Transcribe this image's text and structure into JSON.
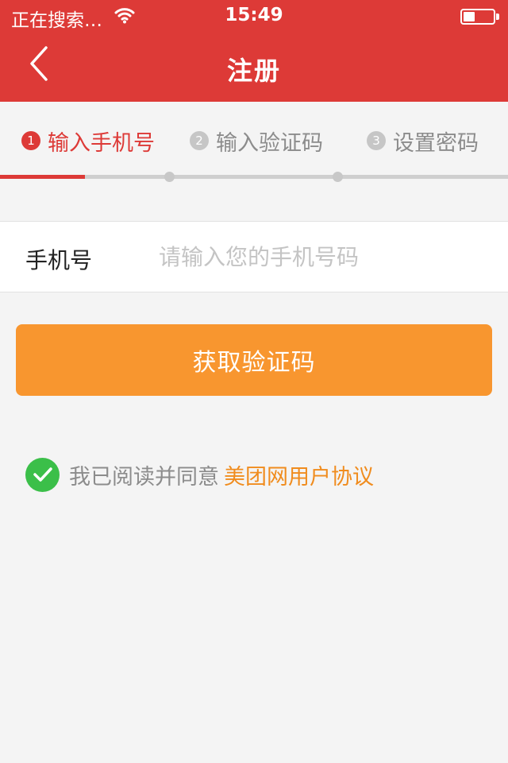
{
  "status_bar": {
    "carrier": "正在搜索…",
    "time": "15:49",
    "battery_level": 0.4
  },
  "nav": {
    "title": "注册",
    "back_icon": "chevron-left-icon"
  },
  "steps": {
    "current_step": 1,
    "items": [
      {
        "num": "1",
        "label": "输入手机号"
      },
      {
        "num": "2",
        "label": "输入验证码"
      },
      {
        "num": "3",
        "label": "设置密码"
      }
    ]
  },
  "form": {
    "phone_label": "手机号",
    "phone_placeholder": "请输入您的手机号码",
    "phone_value": ""
  },
  "get_code_button": {
    "label": "获取验证码"
  },
  "agreement": {
    "checked": true,
    "text": "我已阅读并同意",
    "link": "美团网用户协议"
  },
  "colors": {
    "brand_red": "#dd3a37",
    "button_orange": "#f8962f",
    "link_orange": "#f08c1e",
    "check_green": "#3bbf49",
    "background": "#f4f4f4"
  }
}
